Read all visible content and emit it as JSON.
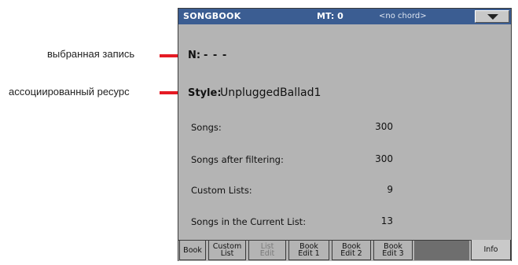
{
  "callouts": {
    "selected_entry": "выбранная запись",
    "associated_resource": "ассоциированный ресурс"
  },
  "header": {
    "title": "SONGBOOK",
    "mt": "MT: 0",
    "chord": "<no chord>",
    "menu_icon": "chevron-down-icon"
  },
  "entry": {
    "n_label": "N:",
    "n_value": "- - -",
    "style_label": "Style:",
    "style_value": "UnpluggedBallad1"
  },
  "info_rows": [
    {
      "label": "Songs:",
      "value": "300"
    },
    {
      "label": "Songs after filtering:",
      "value": "300"
    },
    {
      "label": "Custom Lists:",
      "value": "9"
    },
    {
      "label": "Songs in the Current List:",
      "value": "13"
    }
  ],
  "tabs": [
    {
      "label": "Book",
      "state": "normal"
    },
    {
      "label": "Custom\nList",
      "state": "normal"
    },
    {
      "label": "List\nEdit",
      "state": "disabled"
    },
    {
      "label": "Book\nEdit 1",
      "state": "normal"
    },
    {
      "label": "Book\nEdit 2",
      "state": "normal"
    },
    {
      "label": "Book\nEdit 3",
      "state": "normal"
    },
    {
      "label": "Info",
      "state": "active"
    }
  ],
  "colors": {
    "accent": "#e51b24",
    "titlebar": "#3b5d92",
    "screen_bg": "#b4b4b4"
  }
}
